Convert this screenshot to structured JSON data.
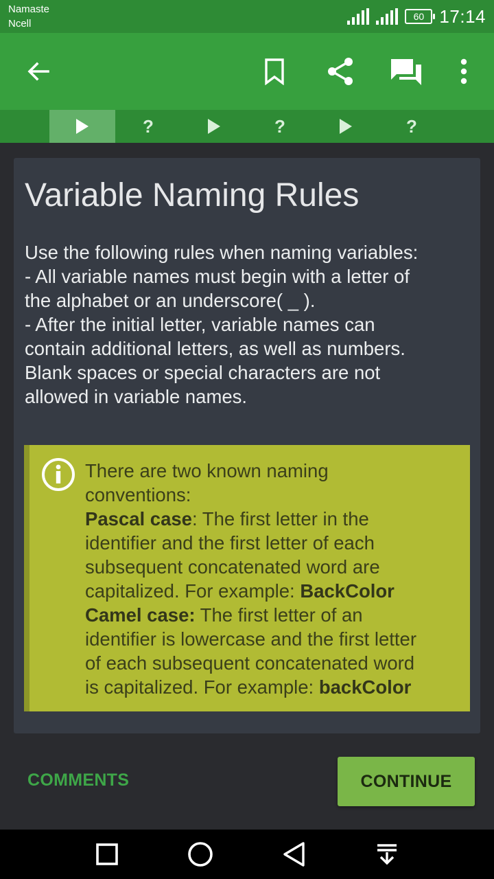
{
  "status_bar": {
    "carrier_1": "Namaste",
    "carrier_2": "Ncell",
    "battery": "60",
    "time": "17:14"
  },
  "app_bar": {
    "icons": [
      "back-arrow-icon",
      "bookmark-icon",
      "share-icon",
      "comments-icon",
      "more-vert-icon"
    ]
  },
  "tabs": [
    {
      "type": "play",
      "active": true
    },
    {
      "type": "quiz",
      "label": "?"
    },
    {
      "type": "play"
    },
    {
      "type": "quiz",
      "label": "?"
    },
    {
      "type": "play"
    },
    {
      "type": "quiz",
      "label": "?"
    }
  ],
  "lesson": {
    "title": "Variable Naming Rules",
    "lines": [
      "Use the following rules when naming variables:",
      "- All variable names must begin with a letter of",
      "the alphabet or an underscore( _ ).",
      "- After the initial letter, variable names can",
      "contain additional letters, as well as numbers.",
      "Blank spaces or special characters are not",
      "allowed in variable names."
    ]
  },
  "note": {
    "line_1": "There are two known naming",
    "line_2": "conventions:",
    "pascal_label": "Pascal case",
    "pascal_rest": ": The first letter in the",
    "line_4": "identifier and the first letter of each",
    "line_5": "subsequent concatenated word are",
    "line_6_text": "capitalized. For example: ",
    "pascal_example": "BackColor",
    "camel_label": "Camel case:",
    "camel_rest": " The first letter of an",
    "line_8": "identifier is lowercase and the first letter",
    "line_9": "of each subsequent concatenated word",
    "line_10_text": "is capitalized. For example: ",
    "camel_example": "backColor"
  },
  "actions": {
    "comments": "COMMENTS",
    "continue": "CONTINUE"
  },
  "colors": {
    "status_bar": "#2e8b35",
    "app_bar": "#37a03e",
    "card": "#363b44",
    "note": "#b1bb34",
    "continue_button": "#7ab648",
    "comments_text": "#3ea648"
  }
}
